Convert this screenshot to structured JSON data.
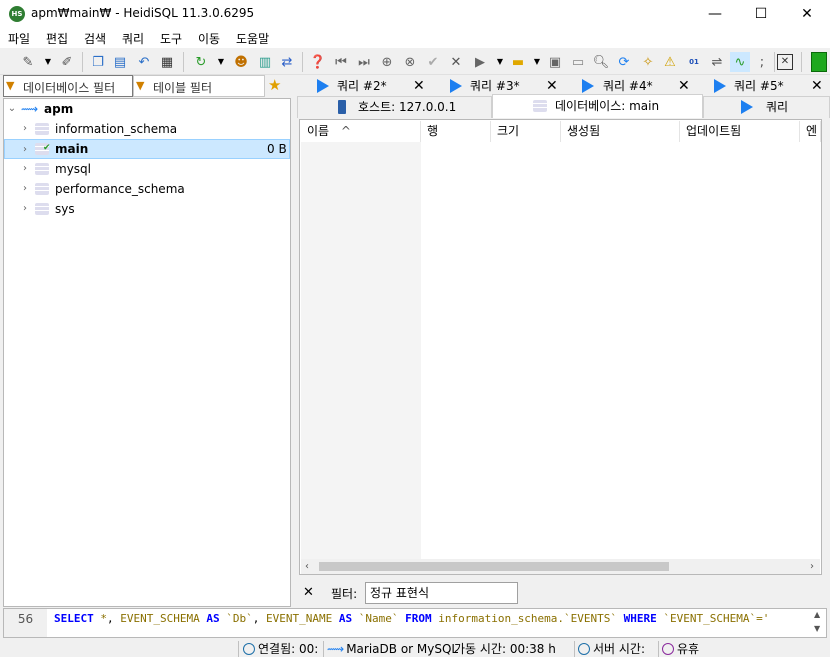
{
  "window": {
    "title": "apm₩main₩ - HeidiSQL 11.3.0.6295",
    "controls": {
      "minimize": "—",
      "maximize": "☐",
      "close": "✕"
    }
  },
  "menu": [
    "파일",
    "편집",
    "검색",
    "쿼리",
    "도구",
    "이동",
    "도움말"
  ],
  "filters": {
    "database_placeholder": "데이터베이스 필터",
    "table_placeholder": "테이블 필터"
  },
  "tree": {
    "root": "apm",
    "items": [
      {
        "name": "information_schema",
        "size": ""
      },
      {
        "name": "main",
        "size": "0 B"
      },
      {
        "name": "mysql",
        "size": ""
      },
      {
        "name": "performance_schema",
        "size": ""
      },
      {
        "name": "sys",
        "size": ""
      }
    ],
    "selected": "main"
  },
  "query_tabs": [
    "쿼리 #2*",
    "쿼리 #3*",
    "쿼리 #4*",
    "쿼리 #5*"
  ],
  "subtabs": [
    {
      "label": "호스트: 127.0.0.1"
    },
    {
      "label": "데이터베이스: main",
      "active": true
    },
    {
      "label": "쿼리"
    }
  ],
  "grid": {
    "columns": [
      "이름",
      "행",
      "크기",
      "생성됨",
      "업데이트됨",
      "엔진"
    ],
    "sort_indicator": "^"
  },
  "filterbar": {
    "close": "✕",
    "label": "필터:",
    "value": "정규 표현식"
  },
  "sql": {
    "line": "56",
    "text": "SELECT *, EVENT_SCHEMA AS `Db`, EVENT_NAME AS `Name` FROM information_schema.`EVENTS` WHERE `EVENT_SCHEMA`='"
  },
  "status": {
    "connected": "연결됨: 00:",
    "server": "MariaDB or MySQL",
    "uptime": "가동 시간: 00:38 h",
    "server_time": "서버 시간: ",
    "idle": "유휴"
  },
  "colors": {
    "accent": "#1d7ff0",
    "selection": "#cce8ff",
    "brand": "#2f7d32"
  }
}
